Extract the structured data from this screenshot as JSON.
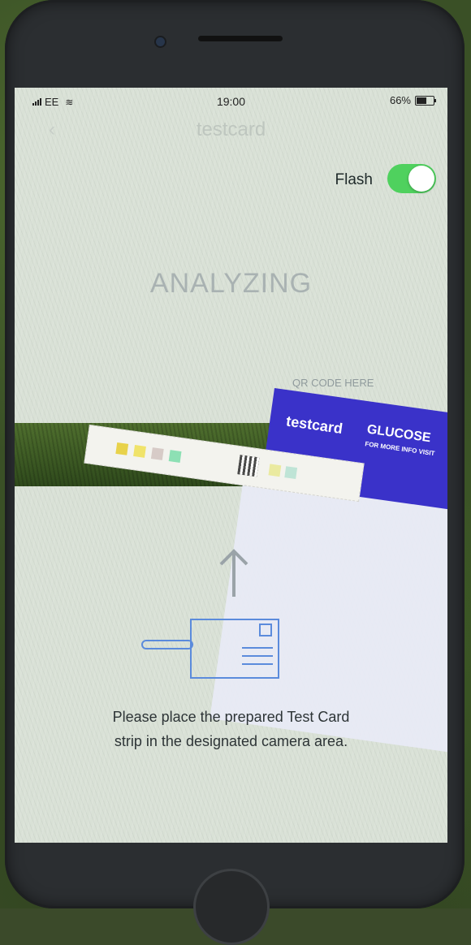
{
  "status_bar": {
    "carrier": "EE",
    "time": "19:00",
    "battery_percent": "66%",
    "battery_level": 0.66
  },
  "nav": {
    "title": "testcard"
  },
  "flash": {
    "label": "Flash",
    "enabled": true
  },
  "main": {
    "status_text": "ANALYZING",
    "qr_hint": "QR CODE HERE",
    "instruction_line1": "Please place the prepared Test Card",
    "instruction_line2": "strip in the designated camera area."
  },
  "photo_card": {
    "brand": "testcard",
    "title": "GLUCOSE",
    "subtitle": "FOR MORE INFO VISIT"
  },
  "colors": {
    "toggle_on": "#4fd15e",
    "accent_blue": "#5b8bdc",
    "card_blue": "#3a32c9"
  },
  "strip_pad_colors": [
    "#e8d24a",
    "#f0e36a",
    "#d7cbc7",
    "#8de0b4",
    "#eaeaa0",
    "#bfe4d6"
  ]
}
